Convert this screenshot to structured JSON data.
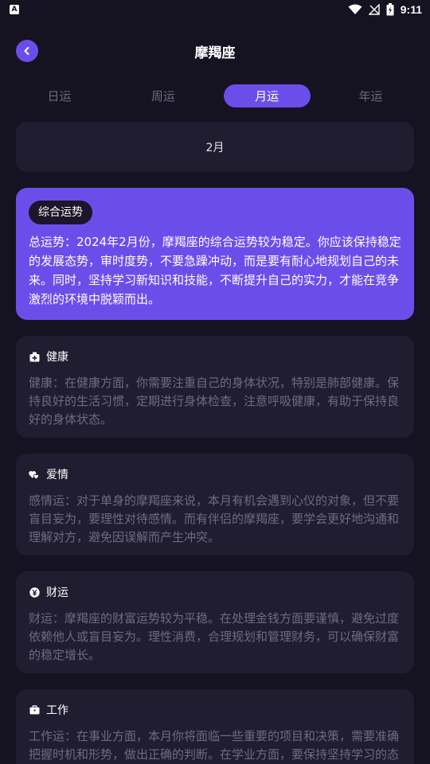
{
  "status_bar": {
    "app_icon_letter": "A",
    "time": "9:11"
  },
  "header": {
    "title": "摩羯座"
  },
  "tabs": [
    {
      "label": "日运",
      "active": false
    },
    {
      "label": "周运",
      "active": false
    },
    {
      "label": "月运",
      "active": true
    },
    {
      "label": "年运",
      "active": false
    }
  ],
  "date_label": "2月",
  "overall": {
    "tag": "综合运势",
    "text": "总运势：2024年2月份，摩羯座的综合运势较为稳定。你应该保持稳定的发展态势，审时度势，不要急躁冲动，而是要有耐心地规划自己的未来。同时，坚持学习新知识和技能，不断提升自己的实力，才能在竞争激烈的环境中脱颖而出。"
  },
  "sections": {
    "health": {
      "icon": "medkit-icon",
      "title": "健康",
      "text": "健康：在健康方面，你需要注重自己的身体状况，特别是肺部健康。保持良好的生活习惯，定期进行身体检查，注意呼吸健康，有助于保持良好的身体状态。"
    },
    "love": {
      "icon": "hearts-icon",
      "title": "爱情",
      "text": "感情运：对于单身的摩羯座来说，本月有机会遇到心仪的对象，但不要盲目妄为，要理性对待感情。而有伴侣的摩羯座，要学会更好地沟通和理解对方，避免因误解而产生冲突。"
    },
    "wealth": {
      "icon": "yen-coin-icon",
      "title": "财运",
      "text": "财运：摩羯座的财富运势较为平稳。在处理金钱方面要谨慎，避免过度依赖他人或盲目妄为。理性消费，合理规划和管理财务，可以确保财富的稳定增长。"
    },
    "work": {
      "icon": "briefcase-icon",
      "title": "工作",
      "text": "工作运：在事业方面，本月你将面临一些重要的项目和决策，需要准确把握时机和形势，做出正确的判断。在学业方面，要保持坚持学习的态"
    }
  },
  "colors": {
    "background": "#151221",
    "accent": "#6b4eea",
    "card": "#211d30",
    "muted_text": "#6f6a80"
  }
}
